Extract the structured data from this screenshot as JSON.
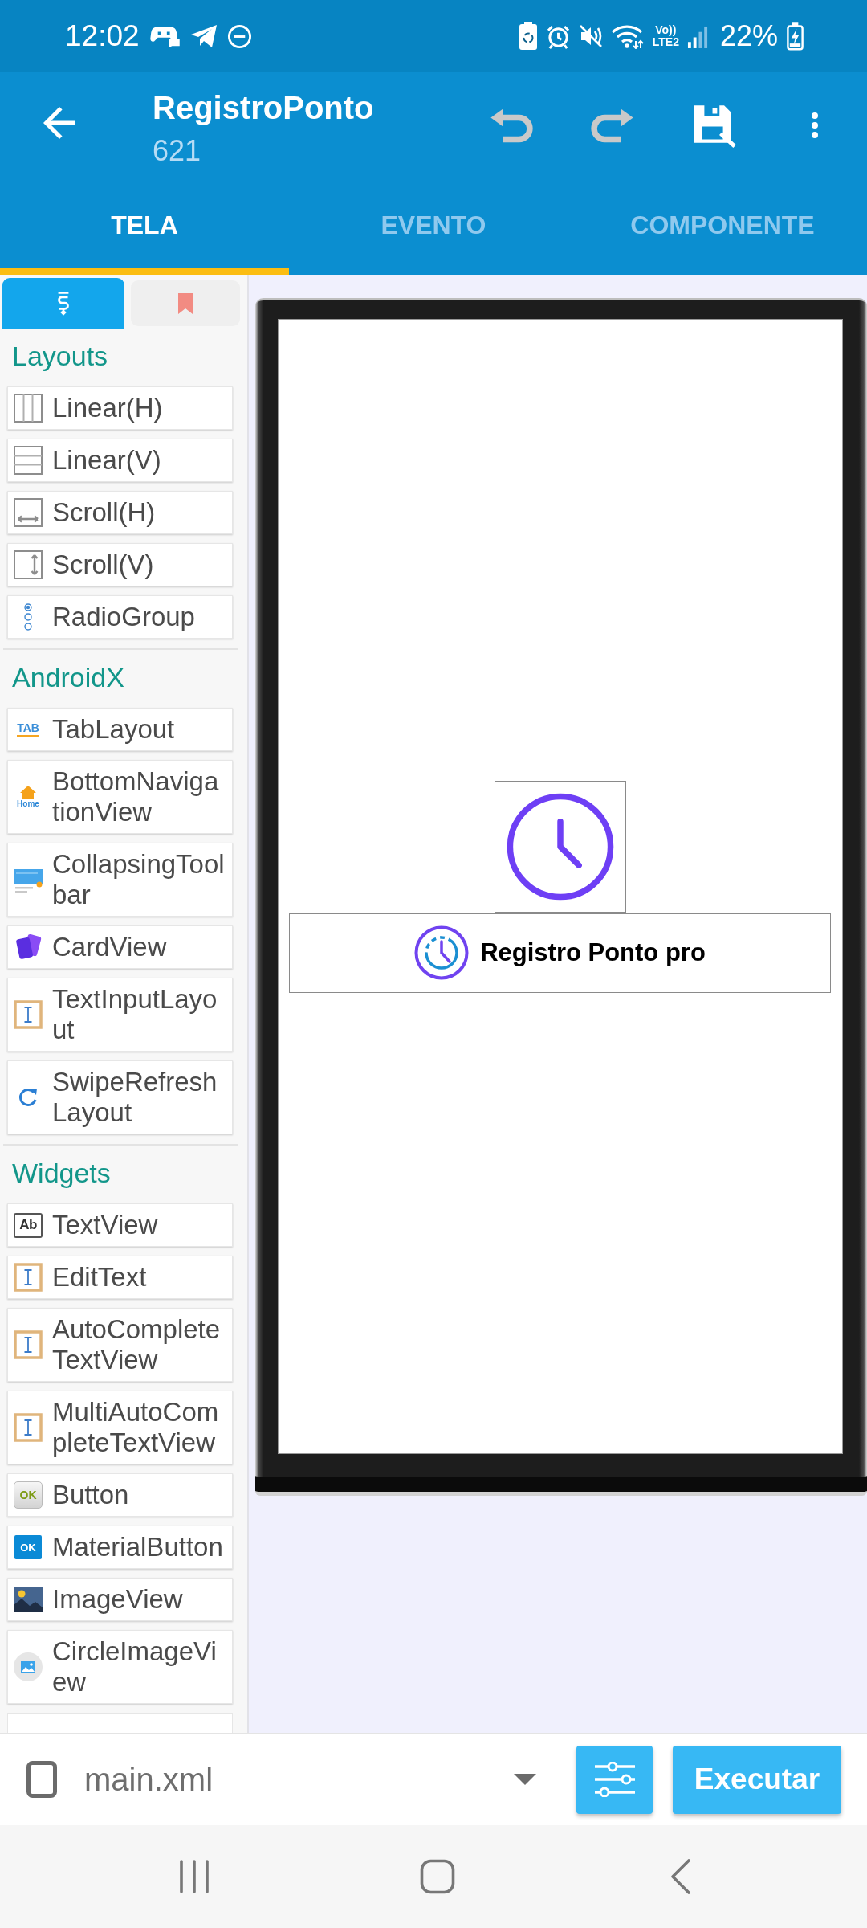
{
  "status_bar": {
    "time": "12:02",
    "volte": "Vo))",
    "network": "LTE2",
    "battery": "22%",
    "charging": true
  },
  "app_bar": {
    "title": "RegistroPonto",
    "subtitle": "621",
    "actions": [
      {
        "kind": "undo",
        "disabled": true
      },
      {
        "kind": "redo",
        "disabled": true
      },
      {
        "kind": "save",
        "disabled": false
      },
      {
        "kind": "more",
        "disabled": false
      }
    ]
  },
  "tabs": [
    {
      "label": "TELA",
      "selected": true
    },
    {
      "label": "EVENTO",
      "selected": false
    },
    {
      "label": "COMPONENTE",
      "selected": false
    }
  ],
  "palette": {
    "tabs": [
      {
        "kind": "components",
        "selected": true
      },
      {
        "kind": "bookmarks",
        "selected": false
      }
    ],
    "sections": [
      {
        "title": "Layouts",
        "items": [
          {
            "label": "Linear(H)",
            "kind": "linear_h"
          },
          {
            "label": "Linear(V)",
            "kind": "linear_v"
          },
          {
            "label": "Scroll(H)",
            "kind": "scroll_h"
          },
          {
            "label": "Scroll(V)",
            "kind": "scroll_v"
          },
          {
            "label": "RadioGroup",
            "kind": "radio_group"
          }
        ]
      },
      {
        "title": "AndroidX",
        "items": [
          {
            "label": "TabLayout",
            "kind": "tab_layout",
            "icon_text": "TAB"
          },
          {
            "label": "BottomNavigationView",
            "kind": "bottom_navigation",
            "icon_text": "Home"
          },
          {
            "label": "CollapsingToolbar",
            "kind": "collapsing_toolbar"
          },
          {
            "label": "CardView",
            "kind": "card_view"
          },
          {
            "label": "TextInputLayout",
            "kind": "text_input"
          },
          {
            "label": "SwipeRefreshLayout",
            "kind": "swipe_refresh"
          }
        ]
      },
      {
        "title": "Widgets",
        "items": [
          {
            "label": "TextView",
            "kind": "text_view",
            "icon_text": "Ab"
          },
          {
            "label": "EditText",
            "kind": "text_input"
          },
          {
            "label": "AutoCompleteTextView",
            "kind": "text_input"
          },
          {
            "label": "MultiAutoCompleteTextView",
            "kind": "text_input"
          },
          {
            "label": "Button",
            "kind": "button",
            "icon_text": "OK"
          },
          {
            "label": "MaterialButton",
            "kind": "material_button",
            "icon_text": "OK"
          },
          {
            "label": "ImageView",
            "kind": "image_view"
          },
          {
            "label": "CircleImageView",
            "kind": "circle_image_view"
          }
        ]
      }
    ],
    "more_below": true
  },
  "canvas": {
    "widgets": [
      {
        "kind": "image_view"
      },
      {
        "kind": "button",
        "label": "Registro Ponto pro"
      }
    ]
  },
  "bottom_bar": {
    "file": "main.xml",
    "run_button": "Executar"
  }
}
